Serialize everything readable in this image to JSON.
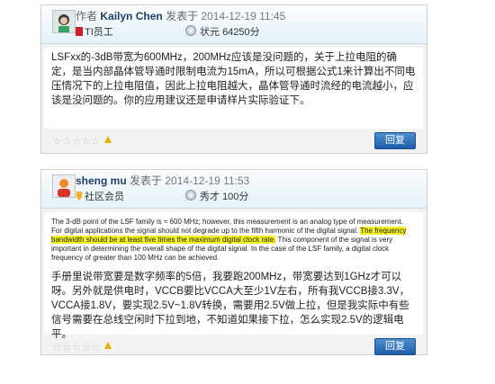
{
  "posts": [
    {
      "label_author": "作者",
      "author": "Kailyn Chen",
      "label_posted": "发表于",
      "datetime": "2014-12-19 11:45",
      "rank": "TI员工",
      "status_label": "状元",
      "points": "64250分",
      "content": "LSFxx的-3dB带宽为600MHz，200MHz应该是没问题的，关于上拉电阻的确定，是当内部晶体管导通时限制电流为15mA，所以可根据公式1来计算出不同电压情况下的上拉电阻值，因此上拉电阻越大，晶体管导通时流经的电流越小，应该是没问题的。你的应用建议还是申请样片实际验证下。",
      "stars": "☆☆☆☆☆",
      "reply_label": "回复"
    },
    {
      "label_author": "",
      "author": "sheng mu",
      "label_posted": "发表于",
      "datetime": "2014-12-19 11:53",
      "rank": "社区会员",
      "status_label": "秀才",
      "points": "100分",
      "quote_lines": [
        "The 3-dB point of the LSF family is ≈ 600 MHz; however, this measurement is an analog type of measurement.",
        "For digital applications the signal should not degrade up to the fifth harmonic of the digital signal.",
        "The frequency bandwidth should be at least five times the maximum digital clock rate.",
        "This component of the signal is very important in determining the overall shape of the digital signal. In the case of the LSF family, a digital clock frequency of greater than 100 MHz can be achieved."
      ],
      "content": "手册里说带宽要是数字频率的5倍，我要跑200MHz，带宽要达到1GHz才可以呀。另外就是供电时，VCCB要比VCCA大至少1V左右，所有我VCCB接3.3V，VCCA接1.8V，要实现2.5V~1.8V转换，需要用2.5V做上拉，但是我实际中有些信号需要在总线空闲时下拉到地，不知道如果接下拉，怎么实现2.5V的逻辑电平。",
      "stars": "☆☆☆☆☆",
      "reply_label": "回复"
    }
  ]
}
